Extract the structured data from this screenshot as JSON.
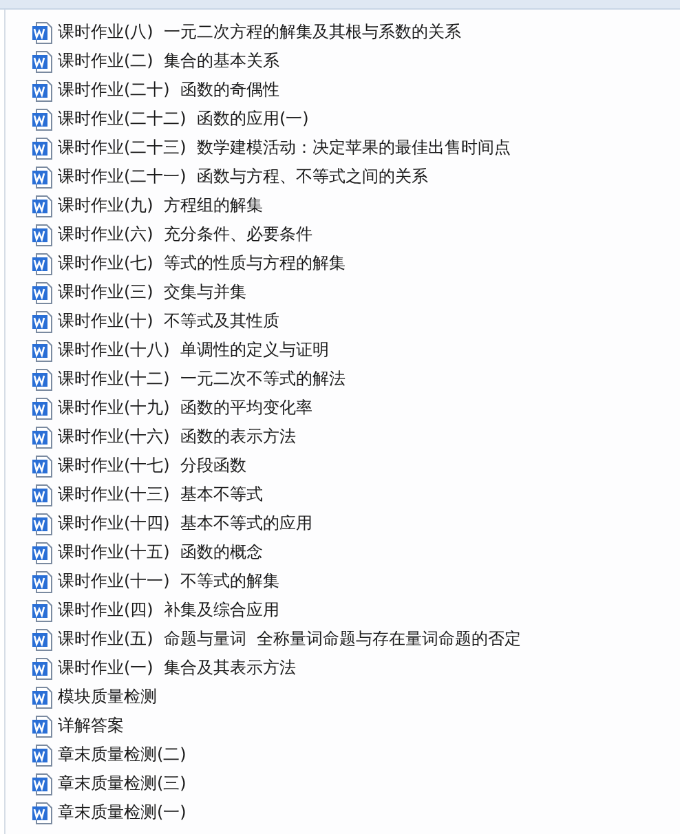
{
  "files": [
    {
      "name": "课时作业(八)  一元二次方程的解集及其根与系数的关系",
      "kind": "word"
    },
    {
      "name": "课时作业(二)  集合的基本关系",
      "kind": "word"
    },
    {
      "name": "课时作业(二十)  函数的奇偶性",
      "kind": "word"
    },
    {
      "name": "课时作业(二十二)  函数的应用(一)",
      "kind": "word"
    },
    {
      "name": "课时作业(二十三)  数学建模活动：决定苹果的最佳出售时间点",
      "kind": "word"
    },
    {
      "name": "课时作业(二十一)  函数与方程、不等式之间的关系",
      "kind": "word"
    },
    {
      "name": "课时作业(九)  方程组的解集",
      "kind": "word"
    },
    {
      "name": "课时作业(六)  充分条件、必要条件",
      "kind": "word"
    },
    {
      "name": "课时作业(七)  等式的性质与方程的解集",
      "kind": "word"
    },
    {
      "name": "课时作业(三)  交集与并集",
      "kind": "word"
    },
    {
      "name": "课时作业(十)  不等式及其性质",
      "kind": "word"
    },
    {
      "name": "课时作业(十八)  单调性的定义与证明",
      "kind": "word"
    },
    {
      "name": "课时作业(十二)  一元二次不等式的解法",
      "kind": "word"
    },
    {
      "name": "课时作业(十九)  函数的平均变化率",
      "kind": "word"
    },
    {
      "name": "课时作业(十六)  函数的表示方法",
      "kind": "word"
    },
    {
      "name": "课时作业(十七)  分段函数",
      "kind": "word"
    },
    {
      "name": "课时作业(十三)  基本不等式",
      "kind": "word"
    },
    {
      "name": "课时作业(十四)  基本不等式的应用",
      "kind": "word"
    },
    {
      "name": "课时作业(十五)  函数的概念",
      "kind": "word"
    },
    {
      "name": "课时作业(十一)  不等式的解集",
      "kind": "word"
    },
    {
      "name": "课时作业(四)  补集及综合应用",
      "kind": "word"
    },
    {
      "name": "课时作业(五)  命题与量词  全称量词命题与存在量词命题的否定",
      "kind": "word"
    },
    {
      "name": "课时作业(一)  集合及其表示方法",
      "kind": "word"
    },
    {
      "name": "模块质量检测",
      "kind": "word"
    },
    {
      "name": "详解答案",
      "kind": "word"
    },
    {
      "name": "章末质量检测(二)",
      "kind": "word"
    },
    {
      "name": "章末质量检测(三)",
      "kind": "word"
    },
    {
      "name": "章末质量检测(一)",
      "kind": "word"
    }
  ]
}
